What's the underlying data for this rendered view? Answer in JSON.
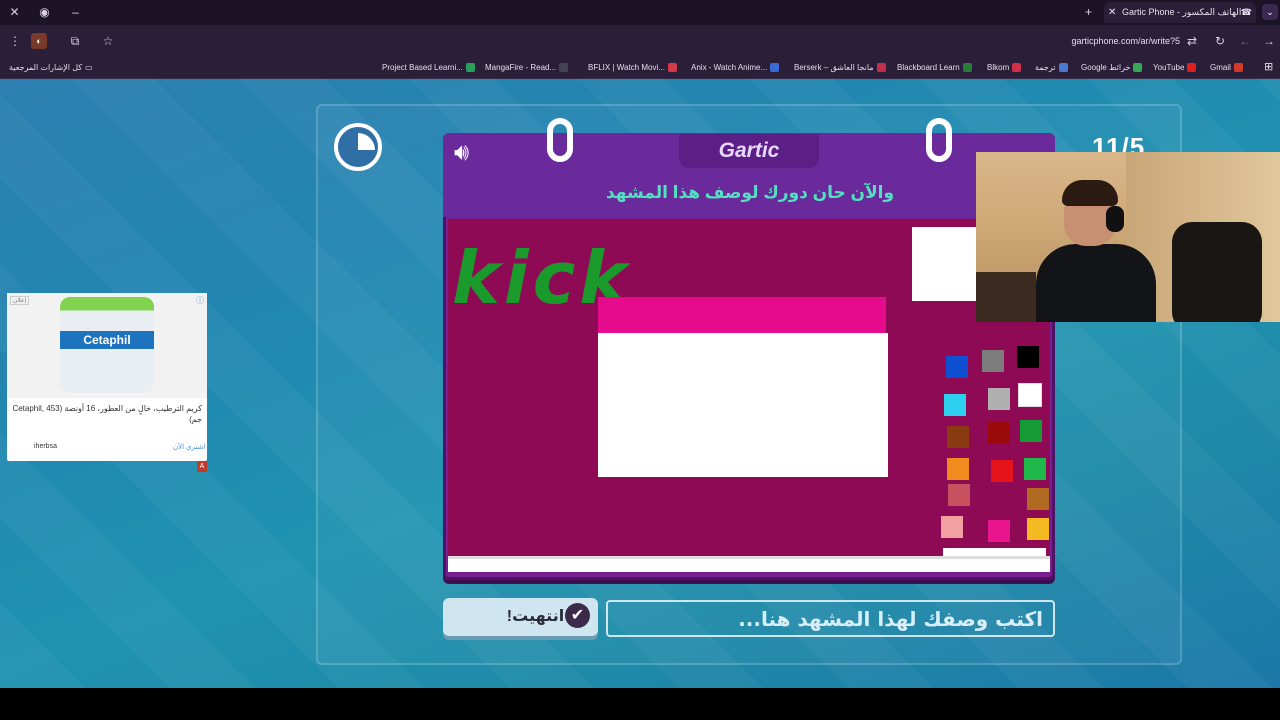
{
  "browser": {
    "tab_title": "Gartic Phone - الهاتف المكسور",
    "url": "garticphone.com/ar/write?5",
    "bookmarks": {
      "all_bookmarks": "كل الإشارات المرجعية",
      "items": [
        "Project Based Learni...",
        "MangaFire - Read...",
        "BFLIX | Watch Movi...",
        "Anix - Watch Anime...",
        "Berserk – مانجا العاشق",
        "Blackboard Learn",
        "Blkom",
        "ترجمة",
        "Google خرائط",
        "YouTube",
        "Gmail"
      ]
    }
  },
  "game": {
    "logo": "Gartic",
    "round_counter": "11/5",
    "prompt": "والآن حان دورك لوصف هذا المشهد",
    "drawing_text": "kick",
    "answer_placeholder": "اكتب وصفك لهذا المشهد هنا...",
    "done_label": "انتهيت!",
    "palette_colors": [
      "#0e4fd2",
      "#7c7c7c",
      "#000000",
      "#2dd0ef",
      "#b0b0b0",
      "#ffffff",
      "#8a3a10",
      "#9a0a0a",
      "#159a35",
      "#f28b1e",
      "#e4141a",
      "#1fb84a",
      "#c9505e",
      "#b06a22",
      "#f2a0a0",
      "#e8158f",
      "#f5b921"
    ]
  },
  "ad": {
    "tag": "إعلان",
    "brand": "Cetaphil",
    "text": "كريم الترطيب، خالٍ من العطور، 16 أونصة (Cetaphil, 453 جم)",
    "advertiser": "iherbsa",
    "cta": "اشتري الآن"
  }
}
